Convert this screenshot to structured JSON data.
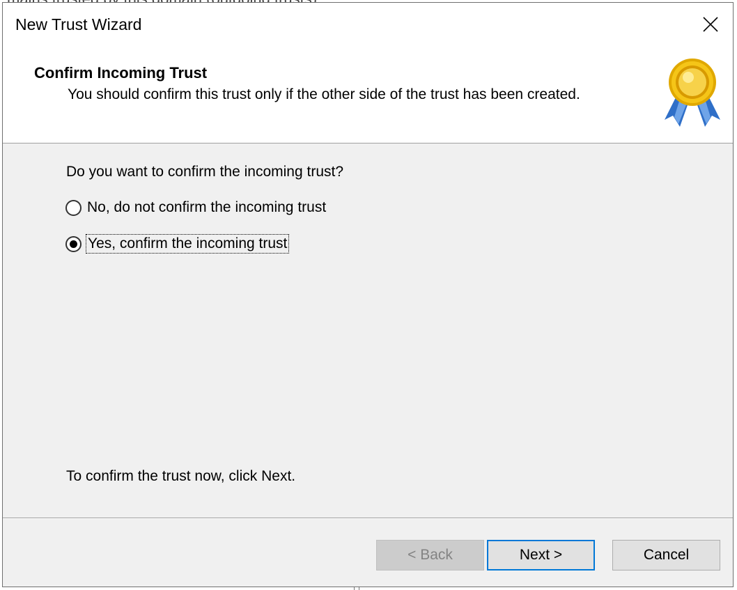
{
  "backdrop": {
    "partial_text": "mains trusted by this domain (outgoing trusts)."
  },
  "window": {
    "title": "New Trust Wizard"
  },
  "header": {
    "title": "Confirm Incoming Trust",
    "subtitle": "You should confirm this trust only if the other side of the trust has been created.",
    "icon": "award-seal-icon"
  },
  "content": {
    "question": "Do you want to confirm the incoming trust?",
    "options": [
      {
        "label": "No, do not confirm the incoming trust",
        "checked": false
      },
      {
        "label": "Yes, confirm the incoming trust",
        "checked": true
      }
    ],
    "hint": "To confirm the trust now, click Next."
  },
  "buttons": {
    "back": "< Back",
    "next": "Next >",
    "cancel": "Cancel"
  },
  "colors": {
    "dialog_bg": "#f0f0f0",
    "header_bg": "#ffffff",
    "focus_border": "#0078d7",
    "disabled_text": "#838383"
  }
}
